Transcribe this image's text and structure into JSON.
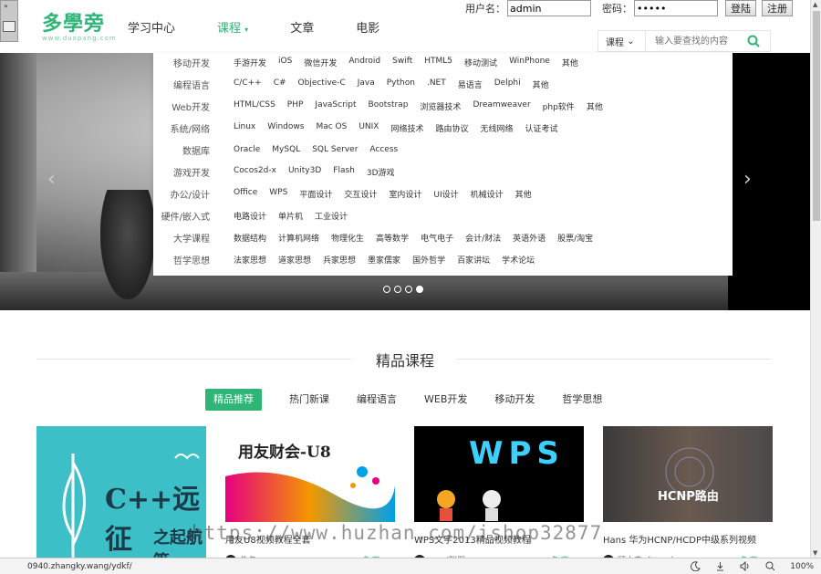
{
  "logo": {
    "main": "多學旁",
    "sub": "www.duopang.com"
  },
  "nav": [
    {
      "label": "学习中心"
    },
    {
      "label": "课程",
      "caret": "▾"
    },
    {
      "label": "文章"
    },
    {
      "label": "电影"
    }
  ],
  "login": {
    "username_label": "用户名：",
    "username_value": "admin",
    "password_label": "密码：",
    "password_value": "•••••",
    "login_btn": "登陆",
    "register_btn": "注册"
  },
  "search": {
    "type_label": "课程",
    "caret": "⌄",
    "placeholder": "输入要查找的内容"
  },
  "dropdown": [
    {
      "cat": "移动开发",
      "links": [
        "手游开发",
        "iOS",
        "微信开发",
        "Android",
        "Swift",
        "HTML5",
        "移动测试",
        "WinPhone",
        "其他"
      ]
    },
    {
      "cat": "编程语言",
      "links": [
        "C/C++",
        "C#",
        "Objective-C",
        "Java",
        "Python",
        ".NET",
        "易语言",
        "Delphi",
        "其他"
      ]
    },
    {
      "cat": "Web开发",
      "links": [
        "HTML/CSS",
        "PHP",
        "JavaScript",
        "Bootstrap",
        "浏览器技术",
        "Dreamweaver",
        "php软件",
        "其他"
      ]
    },
    {
      "cat": "系统/网络",
      "links": [
        "Linux",
        "Windows",
        "Mac OS",
        "UNIX",
        "网络技术",
        "路由协议",
        "无线网络",
        "认证考试"
      ]
    },
    {
      "cat": "数据库",
      "links": [
        "Oracle",
        "MySQL",
        "SQL Server",
        "Access"
      ]
    },
    {
      "cat": "游戏开发",
      "links": [
        "Cocos2d-x",
        "Unity3D",
        "Flash",
        "3D游戏"
      ]
    },
    {
      "cat": "办公/设计",
      "links": [
        "Office",
        "WPS",
        "平面设计",
        "交互设计",
        "室内设计",
        "UI设计",
        "机械设计",
        "其他"
      ]
    },
    {
      "cat": "硬件/嵌入式",
      "links": [
        "电路设计",
        "单片机",
        "工业设计"
      ]
    },
    {
      "cat": "大学课程",
      "links": [
        "数据结构",
        "计算机网络",
        "物理化生",
        "高等数学",
        "电气电子",
        "会计/财法",
        "英语外语",
        "股票/淘宝"
      ]
    },
    {
      "cat": "哲学思想",
      "links": [
        "法家思想",
        "道家思想",
        "兵家思想",
        "墨家儒家",
        "国外哲学",
        "百家讲坛",
        "学术论坛"
      ]
    }
  ],
  "banner": {
    "prev": "‹",
    "next": "›",
    "active_slide": 4,
    "slides": 4
  },
  "section": {
    "title": "精品课程"
  },
  "tabs": [
    "精品推荐",
    "热门新课",
    "编程语言",
    "WEB开发",
    "移动开发",
    "哲学思想"
  ],
  "cards": [
    {
      "title": "",
      "img_text1": "C++远征",
      "img_text2": "之起航篇",
      "author": "",
      "price": ""
    },
    {
      "title": "用友U8视频教程全套",
      "img_text": "用友财会-U8",
      "author": "佚名",
      "price": "免费"
    },
    {
      "title": "WPS文字2013精品视频教程",
      "img_text": "WPS",
      "author": "word联盟",
      "price": "免费"
    },
    {
      "title": "Hans 华为HCNP/HCDP中级系列视频",
      "img_text": "HCNP路由",
      "author": "顾大良（Hans）",
      "price": "免费"
    }
  ],
  "watermark": "https://www.huzhan.com/ishop32877",
  "status": {
    "url": "0940.zhangky.wang/ydkf/",
    "zoom": "100%"
  },
  "colors": {
    "accent": "#2fb576"
  }
}
